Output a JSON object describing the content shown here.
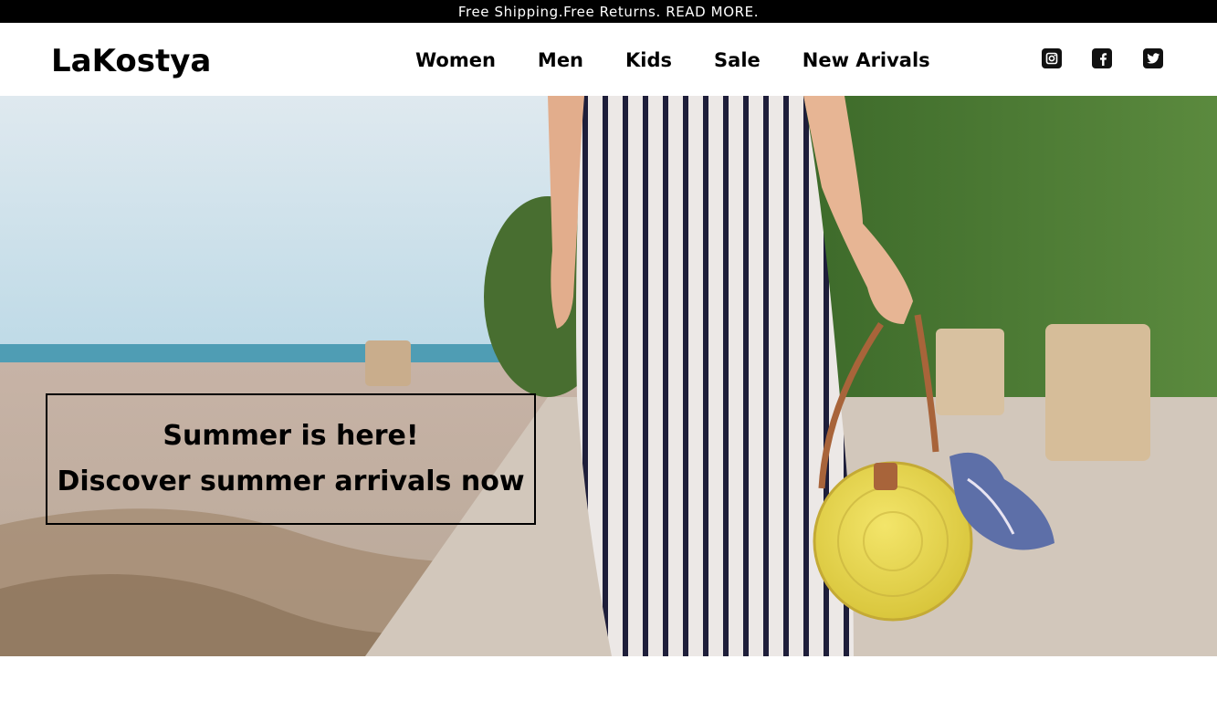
{
  "announcement": {
    "text": "Free Shipping.Free Returns. READ MORE."
  },
  "header": {
    "logo": "LaKostya",
    "nav": [
      {
        "label": "Women"
      },
      {
        "label": "Men"
      },
      {
        "label": "Kids"
      },
      {
        "label": "Sale"
      },
      {
        "label": "New Arivals"
      }
    ],
    "social": [
      {
        "icon": "instagram-icon"
      },
      {
        "icon": "facebook-icon"
      },
      {
        "icon": "twitter-icon"
      }
    ]
  },
  "hero": {
    "headline": "Summer is here!",
    "subline": "Discover summer arrivals now"
  }
}
